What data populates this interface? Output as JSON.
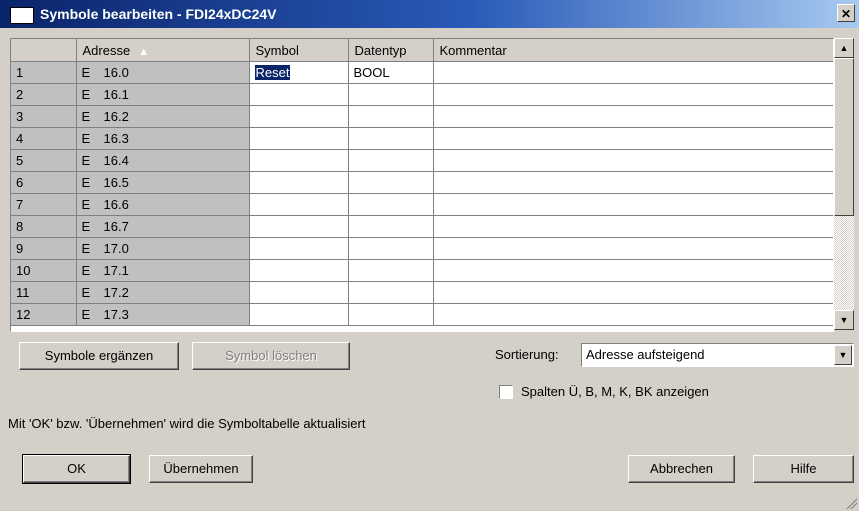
{
  "window": {
    "title": "Symbole bearbeiten - FDI24xDC24V",
    "close_glyph": "✕"
  },
  "grid": {
    "columns": [
      "",
      "Adresse",
      "Symbol",
      "Datentyp",
      "Kommentar"
    ],
    "sort_indicator": "▲",
    "rows": [
      {
        "num": "1",
        "op": "E",
        "addr": "16.0",
        "symbol": "Reset",
        "type": "BOOL",
        "comment": ""
      },
      {
        "num": "2",
        "op": "E",
        "addr": "16.1",
        "symbol": "",
        "type": "",
        "comment": ""
      },
      {
        "num": "3",
        "op": "E",
        "addr": "16.2",
        "symbol": "",
        "type": "",
        "comment": ""
      },
      {
        "num": "4",
        "op": "E",
        "addr": "16.3",
        "symbol": "",
        "type": "",
        "comment": ""
      },
      {
        "num": "5",
        "op": "E",
        "addr": "16.4",
        "symbol": "",
        "type": "",
        "comment": ""
      },
      {
        "num": "6",
        "op": "E",
        "addr": "16.5",
        "symbol": "",
        "type": "",
        "comment": ""
      },
      {
        "num": "7",
        "op": "E",
        "addr": "16.6",
        "symbol": "",
        "type": "",
        "comment": ""
      },
      {
        "num": "8",
        "op": "E",
        "addr": "16.7",
        "symbol": "",
        "type": "",
        "comment": ""
      },
      {
        "num": "9",
        "op": "E",
        "addr": "17.0",
        "symbol": "",
        "type": "",
        "comment": ""
      },
      {
        "num": "10",
        "op": "E",
        "addr": "17.1",
        "symbol": "",
        "type": "",
        "comment": ""
      },
      {
        "num": "11",
        "op": "E",
        "addr": "17.2",
        "symbol": "",
        "type": "",
        "comment": ""
      },
      {
        "num": "12",
        "op": "E",
        "addr": "17.3",
        "symbol": "",
        "type": "",
        "comment": ""
      }
    ]
  },
  "scrollbar": {
    "up_glyph": "▲",
    "down_glyph": "▼"
  },
  "buttons": {
    "add_symbols": "Symbole ergänzen",
    "delete_symbol": "Symbol löschen",
    "ok": "OK",
    "apply": "Übernehmen",
    "cancel": "Abbrechen",
    "help": "Hilfe"
  },
  "sorting": {
    "label": "Sortierung:",
    "value": "Adresse aufsteigend",
    "arrow_glyph": "▼"
  },
  "columns_option": {
    "label": "Spalten Ü, B, M, K, BK anzeigen",
    "checked": false
  },
  "info_text": "Mit 'OK' bzw. 'Übernehmen' wird die Symboltabelle aktualisiert"
}
